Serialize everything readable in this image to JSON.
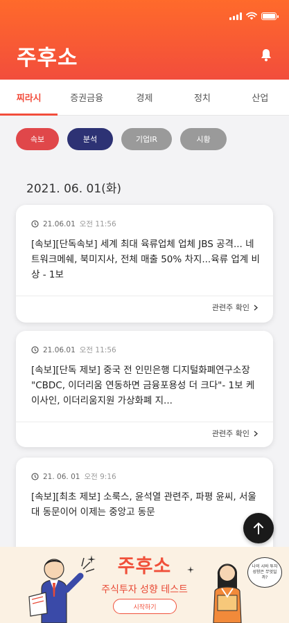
{
  "status_bar": {
    "time": ""
  },
  "header": {
    "logo": "주후소"
  },
  "tabs": [
    {
      "label": "찌라시",
      "active": true
    },
    {
      "label": "증권금융",
      "active": false
    },
    {
      "label": "경제",
      "active": false
    },
    {
      "label": "정치",
      "active": false
    },
    {
      "label": "산업",
      "active": false
    }
  ],
  "chips": [
    {
      "label": "속보",
      "color": "#e0474a"
    },
    {
      "label": "분석",
      "color": "#2d3274"
    },
    {
      "label": "기업IR",
      "color": "#9a9a9a"
    },
    {
      "label": "시황",
      "color": "#9a9a9a"
    }
  ],
  "date_heading": "2021. 06. 01(화)",
  "cards": [
    {
      "date": "21.06.01",
      "time": "오전 11:56",
      "headline": "[속보][단독속보] 세계 최대 육류업체 업체 JBS 공격... 네트워크메쉐, 북미지사, 전체 매출 50% 차지...육류 업계 비상 - 1보",
      "link": "관련주 확인"
    },
    {
      "date": "21.06.01",
      "time": "오전 11:56",
      "headline": "[속보][단독 제보] 중국 전 인민은행 디지털화폐연구소장 \"CBDC, 이더리움 연동하면 금융포용성 더 크다\"- 1보 케이사인, 이더리움지원 가상화폐 지...",
      "link": "관련주 확인"
    },
    {
      "date": "21. 06. 01",
      "time": "오전 9:16",
      "headline": "[속보][최초 제보] 소룩스, 윤석열 관련주, 파평 윤씨, 서울대 동문이어 이제는 중앙고 동문",
      "link": ""
    }
  ],
  "banner": {
    "logo": "주후소",
    "subtitle": "주식투자 성향 테스트",
    "button": "시작하기",
    "bubble": "나의 시바 투자성향은 무엇일까?"
  },
  "colors": {
    "accent": "#f24d3c",
    "header_top": "#ff6a2b"
  },
  "icons": [
    "bell-icon",
    "clock-icon",
    "chevron-right-icon",
    "arrow-up-icon",
    "sparkle-icon"
  ]
}
